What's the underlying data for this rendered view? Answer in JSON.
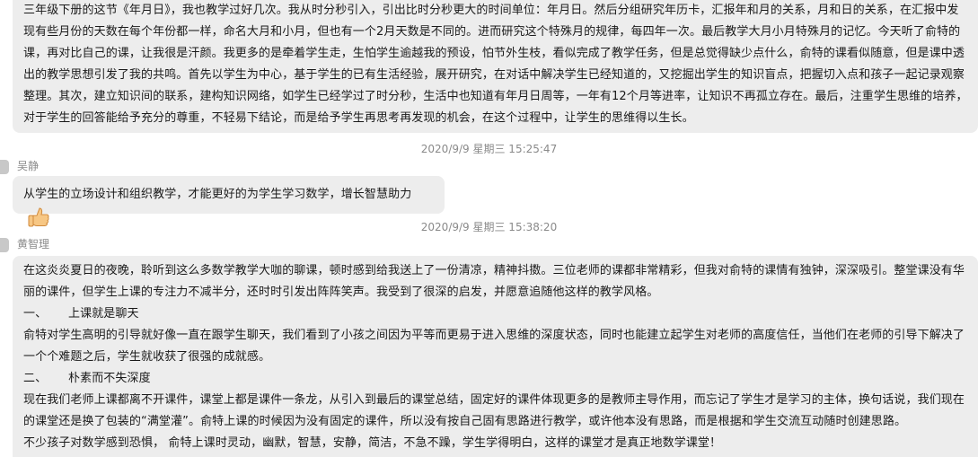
{
  "messages": [
    {
      "text": "三年级下册的这节《年月日》，我也教学过好几次。我从时分秒引入，引出比时分秒更大的时间单位：年月日。然后分组研究年历卡，汇报年和月的关系，月和日的关系，在汇报中发现有些月份的天数在每个年份都一样，命名大月和小月，但也有一个2月天数是不同的。进而研究这个特殊月的规律，每四年一次。最后教学大月小月特殊月的记忆。今天听了俞特的课，再对比自己的课，让我很是汗颜。我更多的是牵着学生走，生怕学生逾越我的预设，怕节外生枝，看似完成了教学任务，但是总觉得缺少点什么，俞特的课看似随意，但是课中透出的教学思想引发了我的共鸣。首先以学生为中心，基于学生的已有生活经验，展开研究，在对话中解决学生已经知道的，又挖掘出学生的知识盲点，把握切入点和孩子一起记录观察整理。其次，建立知识间的联系，建构知识网络，如学生已经学过了时分秒，生活中也知道有年月日周等，一年有12个月等进率，让知识不再孤立存在。最后，注重学生思维的培养，对于学生的回答能给予充分的尊重，不轻易下结论，而是给予学生再思考再发现的机会，在这个过程中，让学生的思维得以生长。"
    },
    {
      "timestamp": "2020/9/9 星期三 15:25:47",
      "sender": "吴静",
      "text": "从学生的立场设计和组织教学，才能更好的为学生学习数学，增长智慧助力",
      "emoji": "thumbs-up"
    },
    {
      "timestamp": "2020/9/9 星期三 15:38:20",
      "sender": "黄智理",
      "paragraphs": [
        "在这炎炎夏日的夜晚，聆听到这么多数学教学大咖的聊课，顿时感到给我送上了一份清凉，精神抖擞。三位老师的课都非常精彩，但我对俞特的课情有独钟，深深吸引。整堂课没有华丽的课件，但学生上课的专注力不减半分，还时时引发出阵阵笑声。我受到了很深的启发，并愿意追随他这样的教学风格。",
        "上课就是聊天",
        "俞特对学生高明的引导就好像一直在跟学生聊天，我们看到了小孩之间因为平等而更易于进入思维的深度状态，同时也能建立起学生对老师的高度信任，当他们在老师的引导下解决了一个个难题之后，学生就收获了很强的成就感。",
        "朴素而不失深度",
        "现在我们老师上课都离不开课件，课堂上都是课件一条龙，从引入到最后的课堂总结，固定好的课件体现更多的是教师主导作用，而忘记了学生才是学习的主体，换句话说，我们现在的课堂还是换了包装的“满堂灌”。俞特上课的时候因为没有固定的课件，所以没有按自己固有思路进行教学，或许他本没有思路，而是根据和学生交流互动随时创建思路。",
        "不少孩子对数学感到恐惧， 俞特上课时灵动，幽默，智慧，安静，简洁，不急不躁，学生学得明白，这样的课堂才是真正地数学课堂！"
      ],
      "heading_numbers": [
        "一、",
        "二、"
      ]
    }
  ]
}
